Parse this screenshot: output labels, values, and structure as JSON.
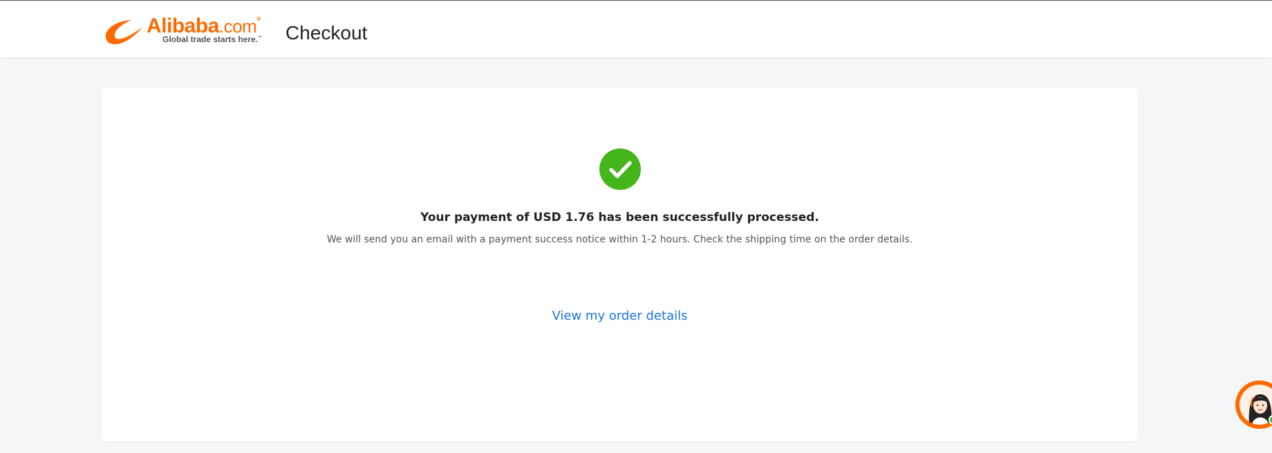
{
  "header": {
    "logo": {
      "brand_main": "Alibaba",
      "brand_suffix": ".com",
      "registered_mark": "®",
      "tagline": "Global trade starts here.",
      "tagline_mark": "™"
    },
    "page_title": "Checkout"
  },
  "main": {
    "status_icon": "success-check-icon",
    "title": "Your payment of USD 1.76 has been successfully processed.",
    "subtitle": "We will send you an email with a payment success notice within 1-2 hours. Check the shipping time on the order details.",
    "order_link_label": "View my order details"
  },
  "chat_widget": {
    "icon": "support-agent-avatar-icon",
    "status": "online"
  },
  "colors": {
    "brand": "#ff6a00",
    "success": "#44b51b",
    "link": "#1a73e8",
    "page_bg": "#f5f6f8"
  }
}
